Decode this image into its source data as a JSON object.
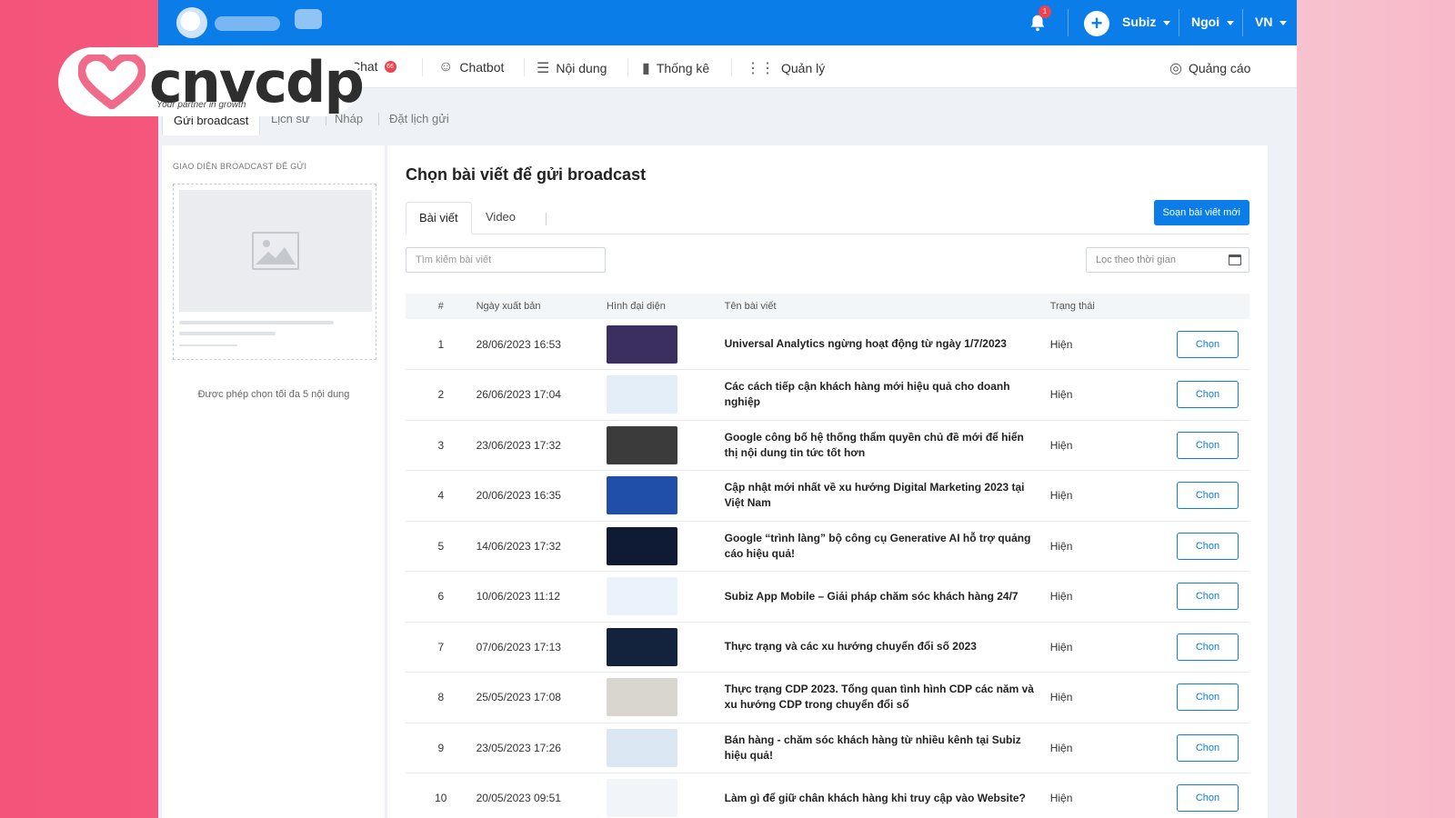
{
  "brand": {
    "name": "cnvcdp",
    "tagline": "Your partner in growth"
  },
  "topbar": {
    "notification_count": "1",
    "account": "Subiz",
    "user": "Ngoi",
    "language": "VN"
  },
  "menu": {
    "chat": "Chat",
    "chat_badge": "66",
    "chatbot": "Chatbot",
    "content": "Nội dung",
    "stats": "Thống kê",
    "manage": "Quản lý",
    "ads": "Quảng cáo"
  },
  "subtabs": {
    "send": "Gửi broadcast",
    "history": "Lịch sử",
    "draft": "Nháp",
    "schedule": "Đặt lịch gửi"
  },
  "left_panel": {
    "title": "GIAO DIỆN BROADCAST ĐỂ GỬI",
    "note": "Được phép chọn tối đa 5 nội dung"
  },
  "main": {
    "title": "Chọn bài viết để gửi broadcast",
    "tab_article": "Bài viết",
    "tab_video": "Video",
    "new_button": "Soạn bài viết mới",
    "search_placeholder": "Tìm kiếm bài viết",
    "date_filter_placeholder": "Lọc theo thời gian"
  },
  "table": {
    "headers": {
      "num": "#",
      "date": "Ngày xuất bản",
      "thumb": "Hình đại diện",
      "name": "Tên bài viết",
      "status": "Trạng thái"
    },
    "choose_label": "Chọn",
    "rows": [
      {
        "num": "1",
        "date": "28/06/2023 16:53",
        "name": "Universal Analytics ngừng hoạt động từ ngày 1/7/2023",
        "status": "Hiện",
        "thumb_color": "#3a2f5e"
      },
      {
        "num": "2",
        "date": "26/06/2023 17:04",
        "name": "Các cách tiếp cận khách hàng mới hiệu quả cho doanh nghiệp",
        "status": "Hiện",
        "thumb_color": "#e4eef8"
      },
      {
        "num": "3",
        "date": "23/06/2023 17:32",
        "name": "Google công bố hệ thống thẩm quyền chủ đề mới để hiển thị nội dung tin tức tốt hơn",
        "status": "Hiện",
        "thumb_color": "#3b3b3b"
      },
      {
        "num": "4",
        "date": "20/06/2023 16:35",
        "name": "Cập nhật mới nhất về xu hướng Digital Marketing 2023 tại Việt Nam",
        "status": "Hiện",
        "thumb_color": "#1f4fa8"
      },
      {
        "num": "5",
        "date": "14/06/2023 17:32",
        "name": "Google “trình làng” bộ công cụ Generative AI hỗ trợ quảng cáo hiệu quả!",
        "status": "Hiện",
        "thumb_color": "#0f1a33"
      },
      {
        "num": "6",
        "date": "10/06/2023 11:12",
        "name": "Subiz App Mobile – Giải pháp chăm sóc khách hàng 24/7",
        "status": "Hiện",
        "thumb_color": "#eaf2fb"
      },
      {
        "num": "7",
        "date": "07/06/2023 17:13",
        "name": "Thực trạng và các xu hướng chuyển đổi số 2023",
        "status": "Hiện",
        "thumb_color": "#13223d"
      },
      {
        "num": "8",
        "date": "25/05/2023 17:08",
        "name": "Thực trạng CDP 2023. Tổng quan tình hình CDP các năm và xu hướng CDP trong chuyển đổi số",
        "status": "Hiện",
        "thumb_color": "#d9d6cf"
      },
      {
        "num": "9",
        "date": "23/05/2023 17:26",
        "name": "Bán hàng - chăm sóc khách hàng từ nhiều kênh tại Subiz hiệu quả!",
        "status": "Hiện",
        "thumb_color": "#dbe8f3"
      },
      {
        "num": "10",
        "date": "20/05/2023 09:51",
        "name": "Làm gì để giữ chân khách hàng khi truy cập vào Website?",
        "status": "Hiện",
        "thumb_color": "#f1f4f8"
      }
    ]
  },
  "colors": {
    "primary": "#0a7de8",
    "brand_pink": "#f4547a"
  }
}
